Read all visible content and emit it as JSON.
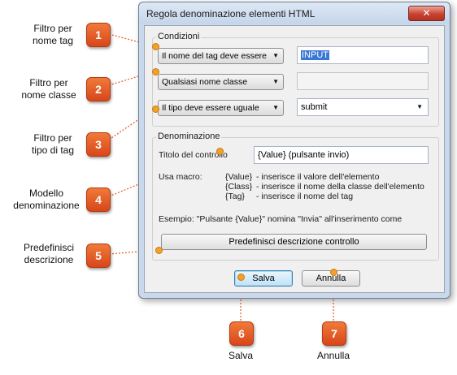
{
  "dialog": {
    "title": "Regola denominazione elementi HTML",
    "close_glyph": "✕"
  },
  "conditions": {
    "group_label": "Condizioni",
    "tag_filter": {
      "selected": "Il nome del tag deve essere",
      "value": "INPUT"
    },
    "class_filter": {
      "selected": "Qualsiasi nome classe",
      "value": ""
    },
    "type_filter": {
      "selected": "Il tipo deve essere uguale",
      "value": "submit"
    }
  },
  "naming": {
    "group_label": "Denominazione",
    "control_title_label": "Titolo del controllo",
    "control_title_value": "{Value} (pulsante invio)",
    "macro_label": "Usa macro:",
    "macros": [
      {
        "key": "{Value}",
        "desc": "- inserisce il valore dell'elemento"
      },
      {
        "key": "{Class}",
        "desc": "- inserisce il nome della classe dell'elemento"
      },
      {
        "key": "{Tag}",
        "desc": "- inserisce il nome del tag"
      }
    ],
    "example": "Esempio:  \"Pulsante {Value}\" nomina \"Invia\" all'inserimento come",
    "default_button": "Predefinisci descrizione controllo"
  },
  "buttons": {
    "save": "Salva",
    "cancel": "Annulla"
  },
  "callouts": [
    {
      "number": "1",
      "label_line1": "Filtro per",
      "label_line2": "nome tag"
    },
    {
      "number": "2",
      "label_line1": "Filtro per",
      "label_line2": "nome classe"
    },
    {
      "number": "3",
      "label_line1": "Filtro per",
      "label_line2": "tipo di tag"
    },
    {
      "number": "4",
      "label_line1": "Modello",
      "label_line2": "denominazione"
    },
    {
      "number": "5",
      "label_line1": "Predefinisci",
      "label_line2": "descrizione"
    },
    {
      "number": "6",
      "label_line1": "Salva"
    },
    {
      "number": "7",
      "label_line1": "Annulla"
    }
  ],
  "colors": {
    "badge": "#e2572a",
    "dot": "#f2a22a",
    "leader": "#e2572a"
  }
}
